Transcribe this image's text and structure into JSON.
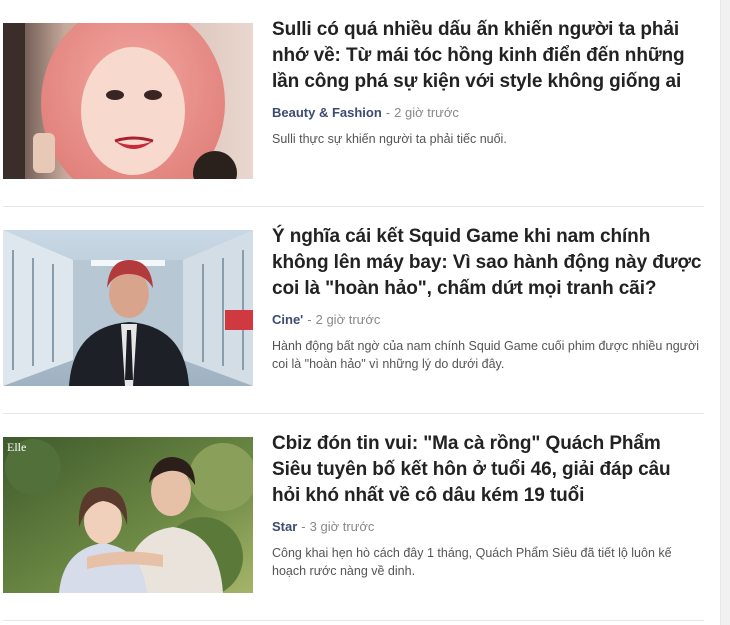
{
  "articles": [
    {
      "title": "Sulli có quá nhiều dấu ấn khiến người ta phải nhớ về: Từ mái tóc hồng kinh điển đến những lần công phá sự kiện với style không giống ai",
      "category": "Beauty & Fashion",
      "separator": "-",
      "time": "2 giờ trước",
      "summary": "Sulli thực sự khiến người ta phải tiếc nuối."
    },
    {
      "title": "Ý nghĩa cái kết Squid Game khi nam chính không lên máy bay: Vì sao hành động này được coi là \"hoàn hảo\", chấm dứt mọi tranh cãi?",
      "category": "Cine'",
      "separator": "-",
      "time": "2 giờ trước",
      "summary": "Hành động bất ngờ của nam chính Squid Game cuối phim được nhiều người coi là \"hoàn hảo\" vì những lý do dưới đây."
    },
    {
      "title": "Cbiz đón tin vui: \"Ma cà rồng\" Quách Phẩm Siêu tuyên bố kết hôn ở tuổi 46, giải đáp câu hỏi khó nhất về cô dâu kém 19 tuổi",
      "category": "Star",
      "separator": "-",
      "time": "3 giờ trước",
      "summary": "Công khai hẹn hò cách đây 1 tháng, Quách Phẩm Siêu đã tiết lộ luôn kế hoạch rước nàng về dinh.",
      "image_watermark": "Elle"
    }
  ]
}
